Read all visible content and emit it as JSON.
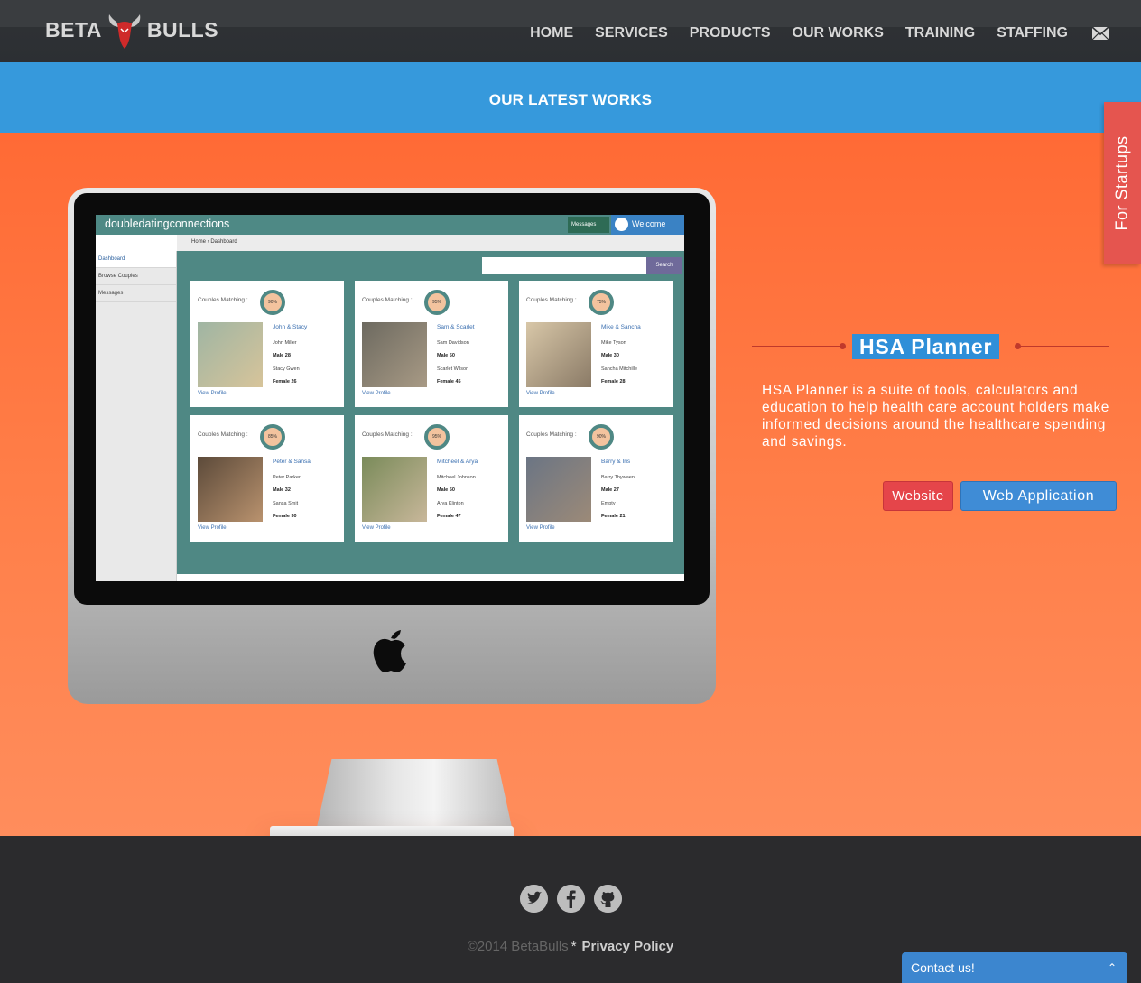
{
  "brand": {
    "left": "BETA",
    "right": "BULLS"
  },
  "nav": [
    {
      "label": "HOME"
    },
    {
      "label": "SERVICES"
    },
    {
      "label": "PRODUCTS"
    },
    {
      "label": "OUR WORKS"
    },
    {
      "label": "TRAINING"
    },
    {
      "label": "STAFFING"
    }
  ],
  "works_title": "OUR LATEST WORKS",
  "project": {
    "title": "HSA Planner",
    "description": "HSA Planner is  a suite of  tools, calculators and education  to help health care  account holders make informed decisions around the healthcare spending and savings.",
    "website_label": "Website",
    "webapp_label": "Web Application"
  },
  "startups_tab": "For Startups",
  "screen": {
    "brand": "doubledatingconnections",
    "messages": "Messages",
    "welcome": "Welcome",
    "breadcrumb": "Home  ›  Dashboard",
    "sidebar": [
      "Dashboard",
      "Browse Couples",
      "Messages"
    ],
    "search": "Search",
    "match_label": "Couples Matching :",
    "view_profile": "View Profile",
    "cards": [
      {
        "pct": "90%",
        "name": "John & Stacy",
        "p1": "John Miller",
        "p1d": "Male 28",
        "p2": "Stacy Gwen",
        "p2d": "Female 26"
      },
      {
        "pct": "95%",
        "name": "Sam & Scarlet",
        "p1": "Sam Davidson",
        "p1d": "Male 50",
        "p2": "Scarlet Wilson",
        "p2d": "Female 45"
      },
      {
        "pct": "75%",
        "name": "Mike & Sancha",
        "p1": "Mike Tyson",
        "p1d": "Male 30",
        "p2": "Sancha Mitchille",
        "p2d": "Female 28"
      },
      {
        "pct": "85%",
        "name": "Peter & Sansa",
        "p1": "Peter Parker",
        "p1d": "Male 32",
        "p2": "Sansa Smit",
        "p2d": "Female 30"
      },
      {
        "pct": "95%",
        "name": "Mitcheel & Arya",
        "p1": "Mitcheel Johnson",
        "p1d": "Male 50",
        "p2": "Arya Klinton",
        "p2d": "Female 47"
      },
      {
        "pct": "90%",
        "name": "Barry & Iris",
        "p1": "Barry Thywaen",
        "p1d": "Male 27",
        "p2": "Empty",
        "p2d": "Female 21"
      }
    ]
  },
  "footer": {
    "copyright": "©2014 BetaBulls",
    "star": "*",
    "privacy": "Privacy Policy",
    "social": [
      "twitter-icon",
      "facebook-icon",
      "github-icon"
    ]
  },
  "contact": {
    "label": "Contact us!"
  },
  "colors": {
    "nav_bg": "#2e3134",
    "band": "#3699dc",
    "main": "#ff7a45",
    "accent_red": "#e5454a",
    "accent_blue": "#3f8cd6"
  }
}
